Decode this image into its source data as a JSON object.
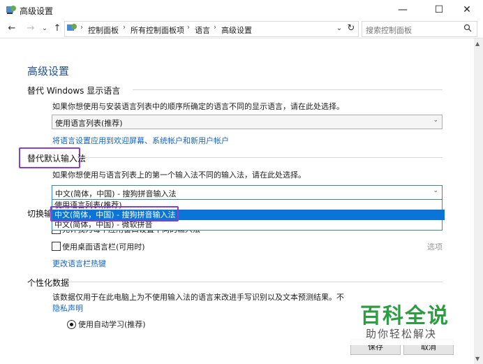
{
  "window": {
    "title": "高级设置",
    "minimize": "—",
    "maximize": "☐",
    "close": "✕"
  },
  "nav": {
    "back": "←",
    "forward": "→",
    "up": "↑",
    "crumbs": [
      "控制面板",
      "所有控制面板项",
      "语言",
      "高级设置"
    ],
    "dropdown": "⌄",
    "refresh": "↻",
    "search_placeholder": "搜索控制面板"
  },
  "page": {
    "heading": "高级设置",
    "override_display": {
      "title": "替代 Windows 显示语言",
      "desc": "如果你想使用与安装语言列表中的顺序所确定的语言不同的显示语言，请在此处选择。",
      "value": "使用语言列表(推荐)",
      "link": "将语言设置应用到欢迎屏幕、系统帐户和新用户帐户"
    },
    "override_input": {
      "title": "替代默认输入法",
      "desc": "如果你想使用与语言列表上的第一个输入法不同的输入法，请在此处选择。",
      "value": "中文(简体，中国) - 搜狗拼音输入法",
      "options": [
        "使用语言列表(推荐)",
        "中文(简体，中国) - 搜狗拼音输入法",
        "中文(简体，中国) - 微软拼音"
      ],
      "selected_index": 1
    },
    "switch_input": {
      "title_partial": "切换输",
      "check1_partial": "允许我为每个应用窗口设置不同的输入法",
      "check2": "使用桌面语言栏(可用时)",
      "options_link": "选项",
      "hotkeys_link": "更改语言栏热键"
    },
    "personalization": {
      "title": "个性化数据",
      "desc": "该数据仅用于在此电脑上为不使用输入法的语言来改进手写识别以及文本预测结果。不会将",
      "privacy_link": "隐私声明",
      "radio1": "使用自动学习(推荐)"
    },
    "buttons": {
      "save": "保存",
      "cancel": "取消"
    }
  },
  "watermark": {
    "main": "百科全说",
    "sub": "助你轻松解决",
    "color": "#2e9c43"
  },
  "colors": {
    "accent": "#1464c0",
    "heading": "#1e4e9a",
    "selection": "#0a74d7",
    "highlight_box": "#8a3fc5"
  }
}
